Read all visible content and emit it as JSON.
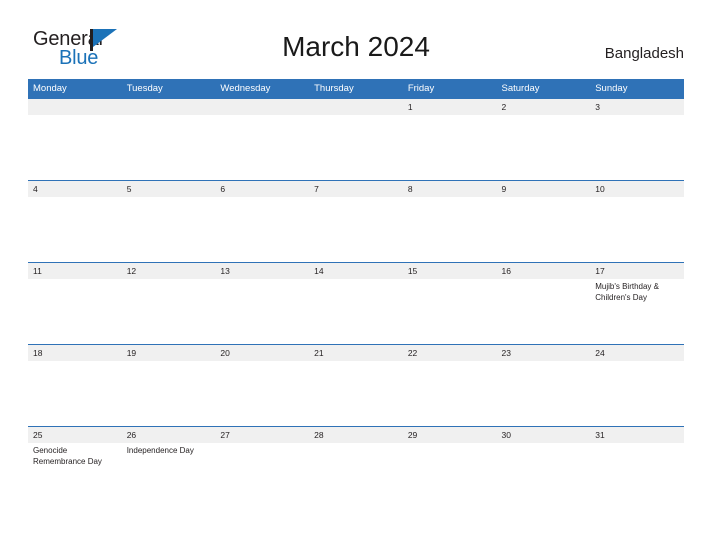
{
  "brand": {
    "name_part1": "General",
    "name_part2": "Blue",
    "flag_icon": "blue-triangle-flag-icon",
    "colors": {
      "dark": "#231f20",
      "blue": "#1b72b8"
    }
  },
  "header": {
    "title": "March 2024",
    "country": "Bangladesh"
  },
  "calendar": {
    "accent_color": "#2f72b7",
    "daynum_band_color": "#f0f0f0",
    "weekday_headers": [
      "Monday",
      "Tuesday",
      "Wednesday",
      "Thursday",
      "Friday",
      "Saturday",
      "Sunday"
    ],
    "weeks": [
      [
        {
          "day": "",
          "events": []
        },
        {
          "day": "",
          "events": []
        },
        {
          "day": "",
          "events": []
        },
        {
          "day": "",
          "events": []
        },
        {
          "day": "1",
          "events": []
        },
        {
          "day": "2",
          "events": []
        },
        {
          "day": "3",
          "events": []
        }
      ],
      [
        {
          "day": "4",
          "events": []
        },
        {
          "day": "5",
          "events": []
        },
        {
          "day": "6",
          "events": []
        },
        {
          "day": "7",
          "events": []
        },
        {
          "day": "8",
          "events": []
        },
        {
          "day": "9",
          "events": []
        },
        {
          "day": "10",
          "events": []
        }
      ],
      [
        {
          "day": "11",
          "events": []
        },
        {
          "day": "12",
          "events": []
        },
        {
          "day": "13",
          "events": []
        },
        {
          "day": "14",
          "events": []
        },
        {
          "day": "15",
          "events": []
        },
        {
          "day": "16",
          "events": []
        },
        {
          "day": "17",
          "events": [
            "Mujib's Birthday & Children's Day"
          ]
        }
      ],
      [
        {
          "day": "18",
          "events": []
        },
        {
          "day": "19",
          "events": []
        },
        {
          "day": "20",
          "events": []
        },
        {
          "day": "21",
          "events": []
        },
        {
          "day": "22",
          "events": []
        },
        {
          "day": "23",
          "events": []
        },
        {
          "day": "24",
          "events": []
        }
      ],
      [
        {
          "day": "25",
          "events": [
            "Genocide Remembrance Day"
          ]
        },
        {
          "day": "26",
          "events": [
            "Independence Day"
          ]
        },
        {
          "day": "27",
          "events": []
        },
        {
          "day": "28",
          "events": []
        },
        {
          "day": "29",
          "events": []
        },
        {
          "day": "30",
          "events": []
        },
        {
          "day": "31",
          "events": []
        }
      ]
    ]
  }
}
